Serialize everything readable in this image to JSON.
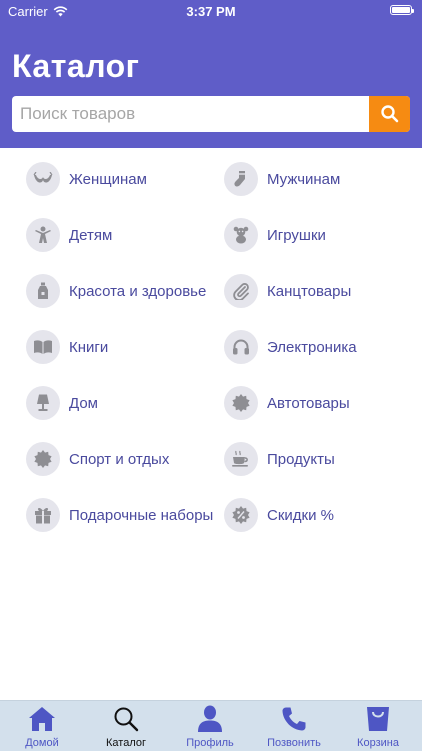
{
  "status": {
    "carrier": "Carrier",
    "time": "3:37 PM"
  },
  "header": {
    "title": "Каталог"
  },
  "search": {
    "placeholder": "Поиск товаров"
  },
  "categories": [
    {
      "label": "Женщинам",
      "icon": "bra-icon"
    },
    {
      "label": "Мужчинам",
      "icon": "sock-icon"
    },
    {
      "label": "Детям",
      "icon": "child-icon"
    },
    {
      "label": "Игрушки",
      "icon": "teddy-bear-icon"
    },
    {
      "label": "Красота и здоровье",
      "icon": "bottle-icon"
    },
    {
      "label": "Канцтовары",
      "icon": "paperclip-icon"
    },
    {
      "label": "Книги",
      "icon": "book-icon"
    },
    {
      "label": "Электроника",
      "icon": "headphones-icon"
    },
    {
      "label": "Дом",
      "icon": "lamp-icon"
    },
    {
      "label": "Автотовары",
      "icon": "gear-icon"
    },
    {
      "label": "Спорт и отдых",
      "icon": "badge-icon"
    },
    {
      "label": "Продукты",
      "icon": "coffee-cup-icon"
    },
    {
      "label": "Подарочные наборы",
      "icon": "gift-icon"
    },
    {
      "label": "Скидки %",
      "icon": "discount-icon"
    }
  ],
  "tabs": [
    {
      "label": "Домой",
      "icon": "home-icon",
      "active": false
    },
    {
      "label": "Каталог",
      "icon": "search-icon",
      "active": true
    },
    {
      "label": "Профиль",
      "icon": "person-icon",
      "active": false
    },
    {
      "label": "Позвонить",
      "icon": "phone-icon",
      "active": false
    },
    {
      "label": "Корзина",
      "icon": "shopping-bag-icon",
      "active": false
    }
  ],
  "colors": {
    "header": "#5f5dc8",
    "search_button": "#f68b12",
    "category_text": "#4a4a9e",
    "icon_circle": "#e5e5ec",
    "icon_gray": "#8e8e93",
    "tabbar": "#d3e0ec",
    "tab_accent": "#4e56c4"
  }
}
